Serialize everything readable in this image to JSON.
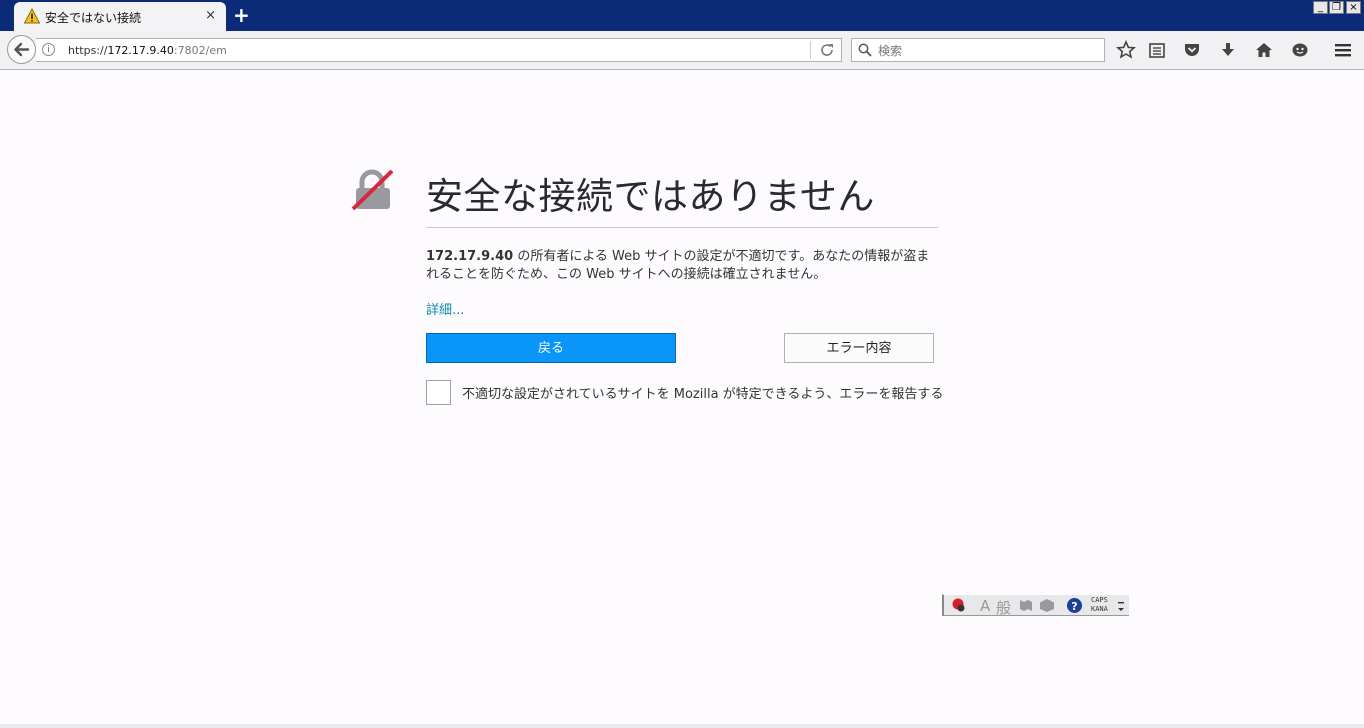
{
  "tab": {
    "title": "安全ではない接続",
    "close": "×"
  },
  "new_tab_label": "+",
  "window_controls": {
    "minimize": "_",
    "restore": "❐",
    "close": "×"
  },
  "address_bar": {
    "scheme": "https://",
    "host": "172.17.9.40",
    "rest": ":7802/em"
  },
  "search": {
    "placeholder": "検索"
  },
  "error_page": {
    "title": "安全な接続ではありません",
    "host": "172.17.9.40",
    "description": " の所有者による Web サイトの設定が不適切です。あなたの情報が盗まれることを防ぐため、この Web サイトへの接続は確立されません。",
    "details_link": "詳細...",
    "back_button": "戻る",
    "advanced_button": "エラー内容",
    "report_checkbox_label": "不適切な設定がされているサイトを Mozilla が特定できるよう、エラーを報告する"
  },
  "ime_bar": {
    "mode": "A",
    "dictionary": "般",
    "help": "?",
    "caps": "CAPS",
    "kana": "KANA"
  },
  "colors": {
    "titlebar": "#0b2a78",
    "primary_button": "#0996f8",
    "link": "#0a8dab",
    "lock_slash": "#d7263d"
  }
}
